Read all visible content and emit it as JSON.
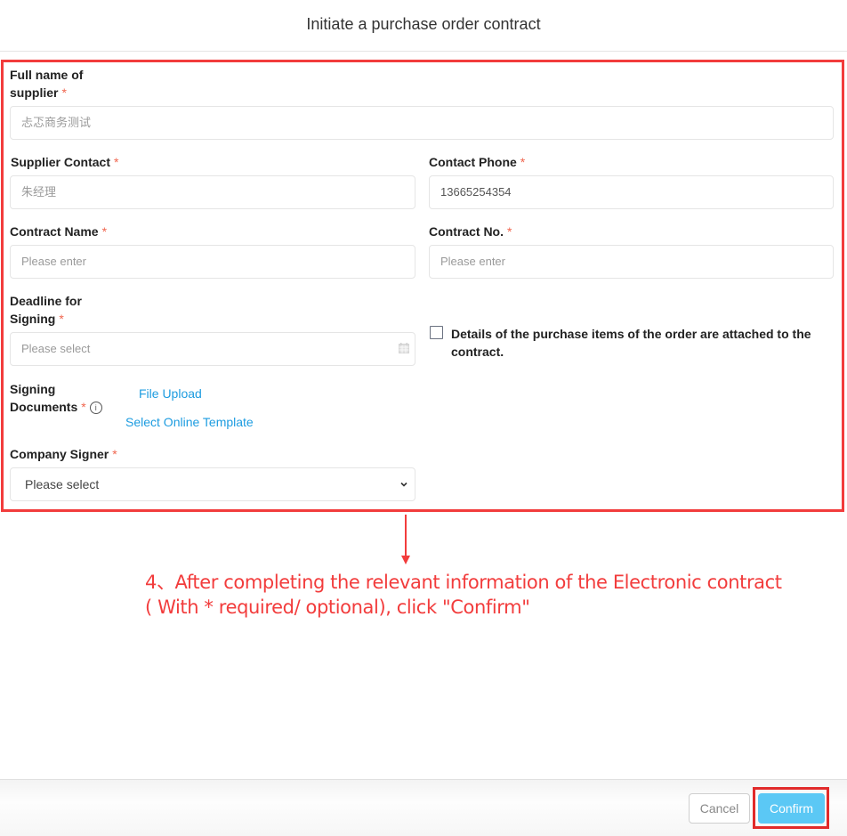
{
  "dialog": {
    "title": "Initiate a purchase order contract"
  },
  "form": {
    "supplier_full_name": {
      "label_line1": "Full name of",
      "label_line2": "supplier",
      "required_mark": "*",
      "placeholder": "忐忑商务测试"
    },
    "supplier_contact": {
      "label": "Supplier Contact",
      "required_mark": "*",
      "placeholder": "朱经理"
    },
    "contact_phone": {
      "label": "Contact Phone",
      "required_mark": "*",
      "value": "13665254354"
    },
    "contract_name": {
      "label": "Contract Name",
      "required_mark": "*",
      "placeholder": "Please enter"
    },
    "contract_no": {
      "label": "Contract No.",
      "required_mark": "*",
      "placeholder": "Please enter"
    },
    "signing_deadline": {
      "label_line1": "Deadline for",
      "label_line2": "Signing",
      "required_mark": "*",
      "placeholder": "Please select",
      "icon": "calendar-icon"
    },
    "attach_details": {
      "checked": false,
      "label": "Details of the purchase items of the order are attached to the contract."
    },
    "signing_documents": {
      "label_line1": "Signing",
      "label_line2": "Documents",
      "required_mark": "*",
      "info_icon": "ⓘ",
      "file_upload_link": "File Upload",
      "online_template_link": "Select Online Template"
    },
    "company_signer": {
      "label": "Company Signer",
      "required_mark": "*",
      "selected": "Please select"
    }
  },
  "annotation": {
    "line1": "4、After completing the relevant information of the Electronic contract",
    "line2": "( With * required/ optional), click \"Confirm\"",
    "color": "#f23c3c"
  },
  "footer": {
    "cancel_label": "Cancel",
    "confirm_label": "Confirm",
    "confirm_color": "#5bc8f5"
  }
}
